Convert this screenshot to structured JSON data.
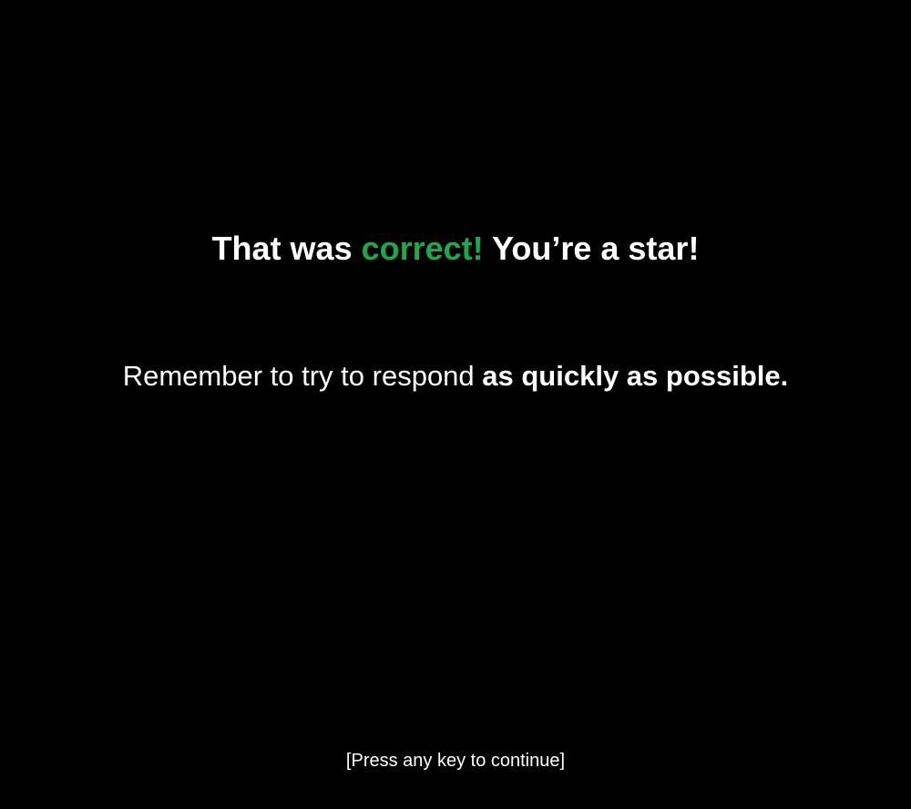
{
  "feedback": {
    "prefix": "That was ",
    "correct_word": "correct!",
    "suffix": " You’re a star!",
    "correct_color": "#1aaa4b"
  },
  "reminder": {
    "prefix": "Remember to try to respond ",
    "emphasis": "as quickly as possible."
  },
  "prompt": {
    "continue_label": "[Press any key to continue]"
  }
}
